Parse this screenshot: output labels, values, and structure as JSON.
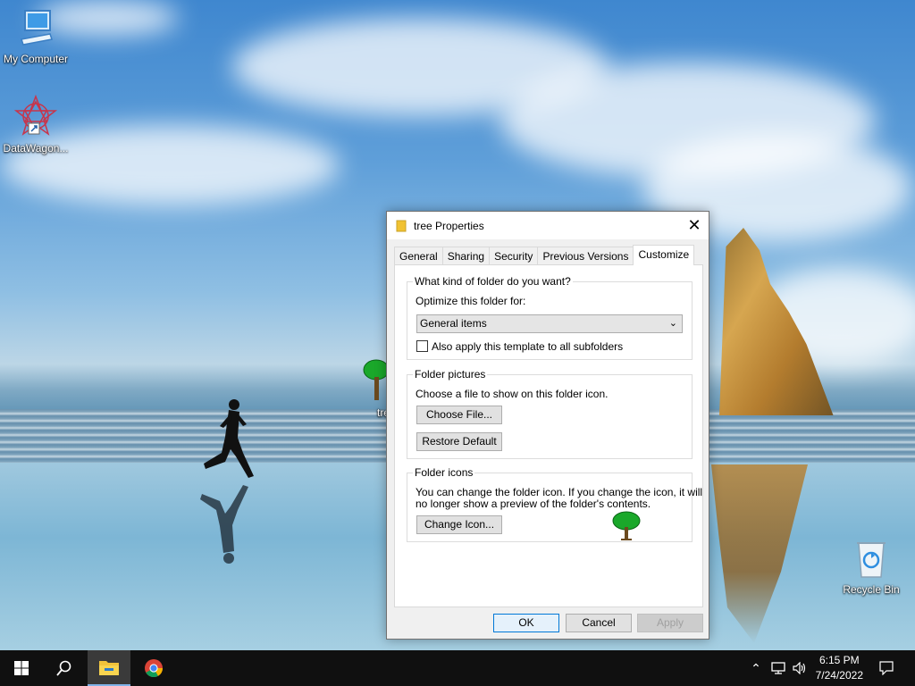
{
  "desktop": {
    "icons": [
      {
        "label": "My Computer"
      },
      {
        "label": "DataWagon..."
      },
      {
        "label": "tre"
      },
      {
        "label": "Recycle Bin"
      }
    ]
  },
  "dialog": {
    "title": "tree Properties",
    "close_glyph": "✕",
    "tabs": [
      "General",
      "Sharing",
      "Security",
      "Previous Versions",
      "Customize"
    ],
    "active_tab": "Customize",
    "folder_type": {
      "legend": "What kind of folder do you want?",
      "optimize_label": "Optimize this folder for:",
      "selected": "General items",
      "apply_subfolders": "Also apply this template to all subfolders",
      "apply_subfolders_checked": false
    },
    "folder_pictures": {
      "legend": "Folder pictures",
      "description": "Choose a file to show on this folder icon.",
      "choose_file": "Choose File...",
      "restore_default": "Restore Default"
    },
    "folder_icons": {
      "legend": "Folder icons",
      "description_line1": "You can change the folder icon. If you change the icon, it will",
      "description_line2": "no longer show a preview of the folder's contents.",
      "change_icon": "Change Icon...",
      "preview_icon": "tree-icon"
    },
    "buttons": {
      "ok": "OK",
      "cancel": "Cancel",
      "apply": "Apply"
    }
  },
  "taskbar": {
    "time": "6:15 PM",
    "date": "7/24/2022",
    "pinned": [
      "start-icon",
      "search-icon",
      "file-explorer-icon",
      "chrome-icon"
    ]
  }
}
